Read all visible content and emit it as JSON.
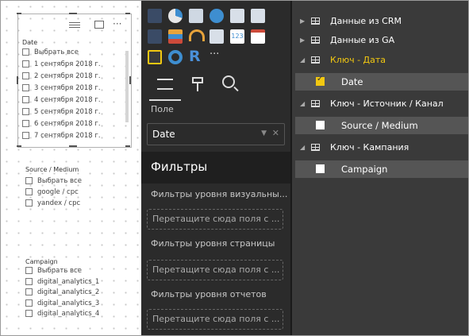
{
  "canvas": {
    "slicer_date": {
      "title": "Date",
      "items": [
        "Выбрать все",
        "1 сентября 2018 г.",
        "2 сентября 2018 г.",
        "3 сентября 2018 г.",
        "4 сентября 2018 г.",
        "5 сентября 2018 г.",
        "6 сентября 2018 г.",
        "7 сентября 2018 г."
      ]
    },
    "slicer_source": {
      "title": "Source / Medium",
      "items": [
        "Выбрать все",
        "google / cpc",
        "yandex / cpc"
      ]
    },
    "slicer_campaign": {
      "title": "Campaign",
      "items": [
        "Выбрать все",
        "digital_analytics_1",
        "digital_analytics_2",
        "digital_analytics_3",
        "digital_analytics_4"
      ]
    },
    "header_icons": [
      "drag-lines-icon",
      "focus-mode-icon",
      "more-options-icon"
    ],
    "more_glyph": "···"
  },
  "visualizations": {
    "icons": [
      "map-icon",
      "pie-chart-icon",
      "table-icon",
      "globe-icon",
      "matrix-icon",
      "grid-icon",
      "filled-map-icon",
      "funnel-icon",
      "gauge-icon",
      "kpi-list-icon",
      "card-123-icon",
      "multi-row-card-icon",
      "slicer-icon",
      "donut-icon",
      "r-visual-icon",
      "more-visuals-icon"
    ],
    "card_text": "123",
    "r_text": "R",
    "more_text": "···",
    "tabs": [
      "fields-tab",
      "format-tab",
      "analytics-tab"
    ],
    "field_section_label": "Поле",
    "field_value": "Date",
    "filters_heading": "Фильтры",
    "visual_filters_label": "Фильтры уровня визуальны...",
    "page_filters_label": "Фильтры уровня страницы",
    "report_filters_label": "Фильтры уровня отчетов",
    "drop_placeholder": "Перетащите сюда поля с ..."
  },
  "fields": {
    "tables": [
      {
        "name": "Данные из CRM",
        "expanded": false
      },
      {
        "name": "Данные из GA",
        "expanded": false
      },
      {
        "name": "Ключ - Дата",
        "expanded": true,
        "field": "Date",
        "checked": true
      },
      {
        "name": "Ключ - Источник / Канал",
        "expanded": true,
        "field": "Source / Medium",
        "checked": false
      },
      {
        "name": "Ключ - Кампания",
        "expanded": true,
        "field": "Campaign",
        "checked": false
      }
    ]
  },
  "colors": {
    "accent_yellow": "#f2c811",
    "pane_dark": "#2b2b2b",
    "fields_bg": "#3a3a3a"
  }
}
